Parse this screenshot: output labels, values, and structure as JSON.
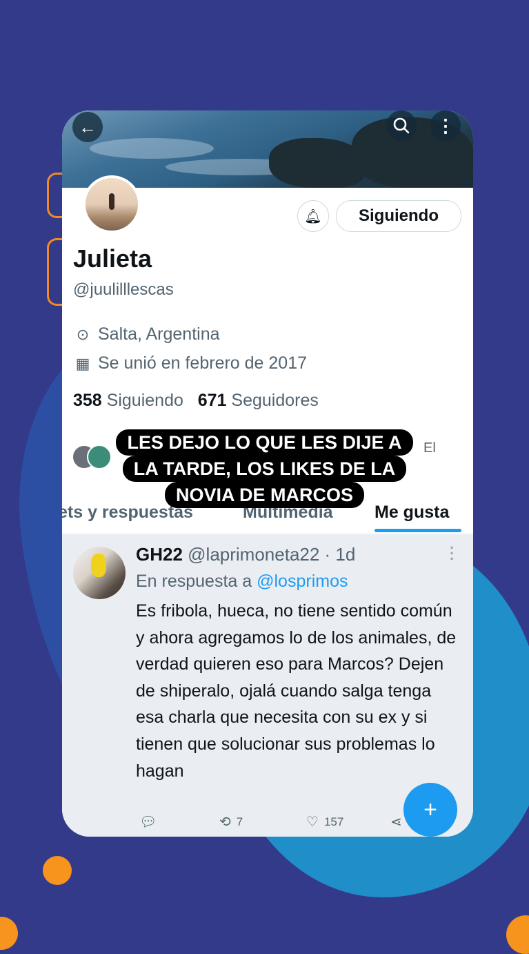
{
  "profile": {
    "name": "Julieta",
    "handle": "@juulilllescas",
    "location": "Salta, Argentina",
    "joined": "Se unió en febrero de 2017",
    "following_count": "358",
    "following_label": "Siguiendo",
    "followers_count": "671",
    "followers_label": "Seguidores",
    "follow_button": "Siguiendo",
    "followed_by_fragment": "El"
  },
  "icons": {
    "back": "arrow-left",
    "search": "search",
    "more": "more-vertical",
    "bell": "bell-plus",
    "location": "map-pin",
    "calendar": "calendar",
    "reply": "comment",
    "retweet": "retweet",
    "like": "heart",
    "share": "share",
    "compose": "plus"
  },
  "tabs": [
    {
      "label": "ets y respuestas"
    },
    {
      "label": "Multimedia"
    },
    {
      "label": "Me gusta",
      "active": true
    }
  ],
  "tweet": {
    "display_name": "GH22",
    "handle_time": "@laprimoneta22 · 1d",
    "reply_prefix": "En respuesta a",
    "reply_to": "@losprimos",
    "text": "Es fribola, hueca, no tiene sentido común y ahora agregamos lo de los animales, de verdad quieren eso para Marcos? Dejen de shiperalo, ojalá cuando salga tenga esa charla que necesita con su ex y si tienen que solucionar sus problemas lo hagan",
    "retweets": "7",
    "likes": "157"
  },
  "caption": {
    "line1": "LES DEJO LO QUE LES DIJE A",
    "line2": "LA TARDE, LOS LIKES DE LA",
    "line3": "NOVIA DE MARCOS"
  },
  "colors": {
    "background": "#343a8a",
    "accent": "#1d9bf0",
    "orange": "#f7941d"
  }
}
